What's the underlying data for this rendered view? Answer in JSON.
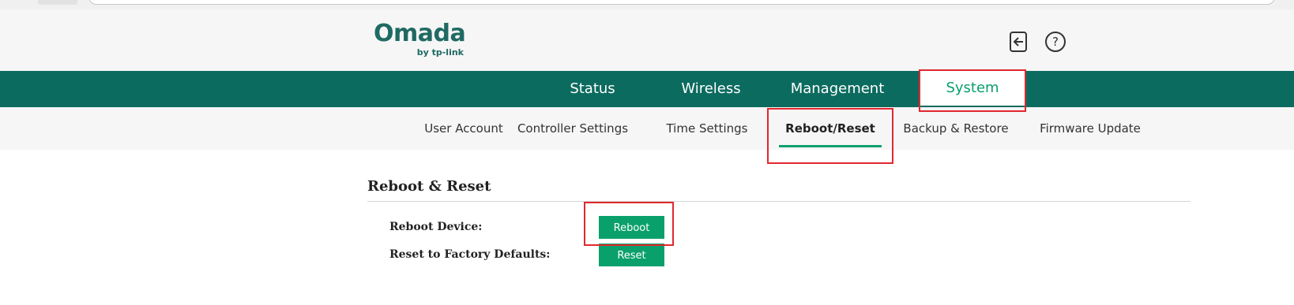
{
  "header": {
    "logo": {
      "brand": "Omada",
      "sub": "by tp-link"
    },
    "icons": [
      "logout-icon",
      "help-icon"
    ]
  },
  "main_nav": {
    "items": [
      {
        "label": "Status"
      },
      {
        "label": "Wireless"
      },
      {
        "label": "Management"
      },
      {
        "label": "System"
      }
    ],
    "active": "System"
  },
  "sub_nav": {
    "items": [
      {
        "label": "User Account"
      },
      {
        "label": "Controller Settings"
      },
      {
        "label": "Time Settings"
      },
      {
        "label": "Reboot/Reset"
      },
      {
        "label": "Backup & Restore"
      },
      {
        "label": "Firmware Update"
      }
    ],
    "active": "Reboot/Reset"
  },
  "content": {
    "title": "Reboot & Reset",
    "rows": [
      {
        "label": "Reboot Device:",
        "button": "Reboot"
      },
      {
        "label": "Reset to Factory Defaults:",
        "button": "Reset"
      }
    ]
  },
  "colors": {
    "brand": "#1f6a63",
    "nav_bg": "#0c6b5f",
    "accent": "#0aa06c",
    "highlight": "#e0282e"
  }
}
